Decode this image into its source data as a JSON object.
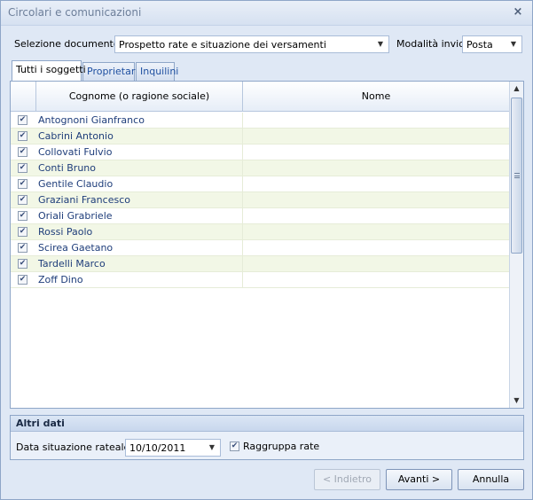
{
  "window": {
    "title": "Circolari e comunicazioni",
    "close": "×"
  },
  "doc": {
    "label": "Selezione documento:",
    "value": "Prospetto rate e situazione dei versamenti",
    "mode_label": "Modalità invio:",
    "mode_value": "Posta"
  },
  "tabs": [
    {
      "label": "Tutti i soggetti"
    },
    {
      "label": "Proprietari"
    },
    {
      "label": "Inquilini"
    }
  ],
  "grid": {
    "columns": [
      "Cognome (o ragione sociale)",
      "Nome"
    ],
    "rows": [
      {
        "name": "Antognoni Gianfranco",
        "nome": "",
        "checked": true
      },
      {
        "name": "Cabrini Antonio",
        "nome": "",
        "checked": true
      },
      {
        "name": "Collovati Fulvio",
        "nome": "",
        "checked": true
      },
      {
        "name": "Conti Bruno",
        "nome": "",
        "checked": true
      },
      {
        "name": "Gentile Claudio",
        "nome": "",
        "checked": true
      },
      {
        "name": "Graziani Francesco",
        "nome": "",
        "checked": true
      },
      {
        "name": "Oriali Grabriele",
        "nome": "",
        "checked": true
      },
      {
        "name": "Rossi Paolo",
        "nome": "",
        "checked": true
      },
      {
        "name": "Scirea Gaetano",
        "nome": "",
        "checked": true
      },
      {
        "name": "Tardelli Marco",
        "nome": "",
        "checked": true
      },
      {
        "name": "Zoff Dino",
        "nome": "",
        "checked": true
      }
    ]
  },
  "altri": {
    "title": "Altri dati",
    "date_label": "Data situazione rateale:",
    "date_value": "10/10/2011",
    "raggruppa_label": "Raggruppa rate",
    "raggruppa_checked": true
  },
  "buttons": {
    "back": "< Indietro",
    "next": "Avanti >",
    "cancel": "Annulla"
  }
}
